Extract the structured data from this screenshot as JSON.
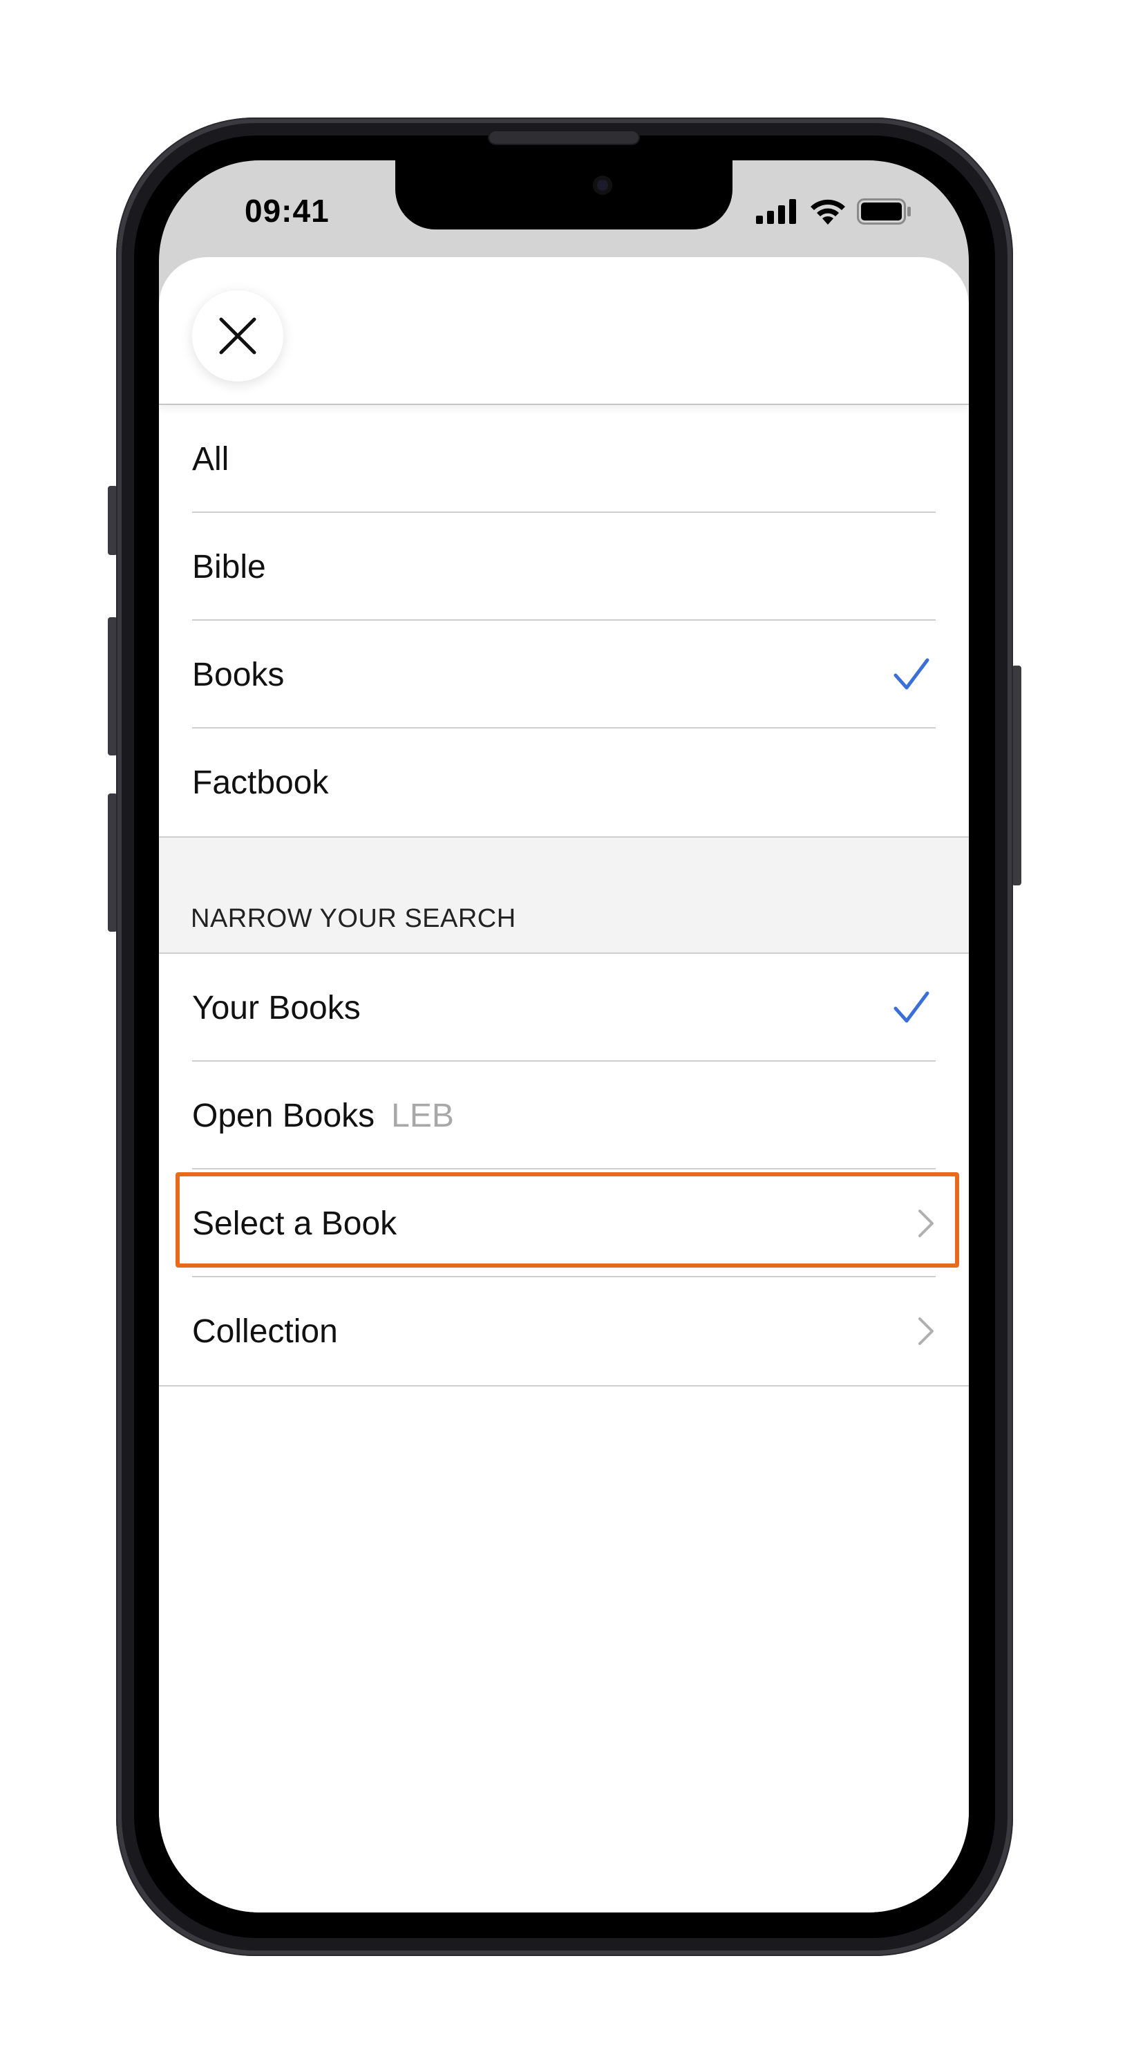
{
  "status_bar": {
    "time": "09:41",
    "icons": [
      "cellular-signal-icon",
      "wifi-icon",
      "battery-icon"
    ]
  },
  "sheet": {
    "close_icon": "close-icon",
    "scopes": [
      {
        "label": "All",
        "checked": false
      },
      {
        "label": "Bible",
        "checked": false
      },
      {
        "label": "Books",
        "checked": true
      },
      {
        "label": "Factbook",
        "checked": false
      }
    ],
    "narrow_section": {
      "title": "NARROW YOUR SEARCH",
      "items": [
        {
          "label": "Your Books",
          "sub": "",
          "checked": true,
          "chevron": false
        },
        {
          "label": "Open Books",
          "sub": "LEB",
          "checked": false,
          "chevron": false
        },
        {
          "label": "Select a Book",
          "sub": "",
          "checked": false,
          "chevron": true,
          "highlighted": true
        },
        {
          "label": "Collection",
          "sub": "",
          "checked": false,
          "chevron": true
        }
      ]
    }
  },
  "colors": {
    "accent_check": "#3a6fd8",
    "highlight_border": "#e86a1c",
    "chevron": "#b0b0b0"
  }
}
